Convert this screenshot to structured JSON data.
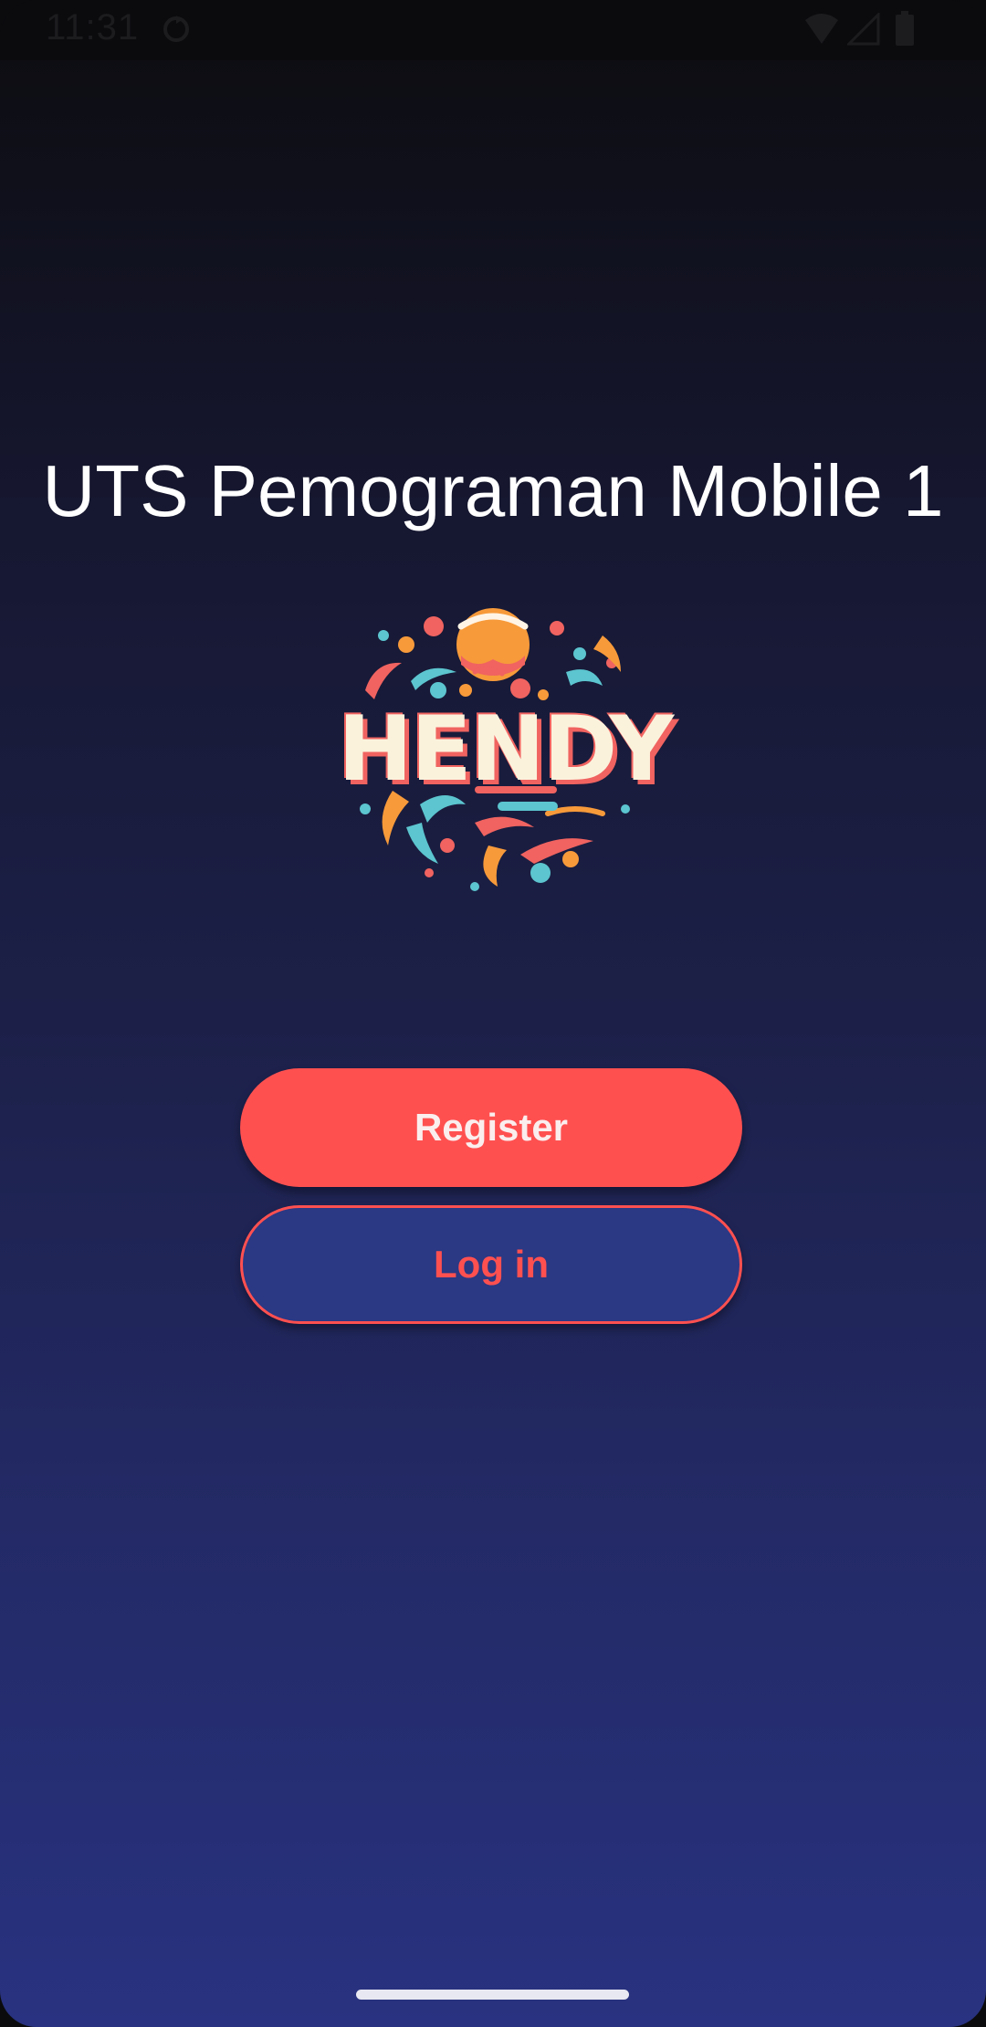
{
  "status_bar": {
    "time": "11:31",
    "icons": [
      "sync-icon",
      "wifi-icon",
      "signal-icon",
      "battery-icon"
    ]
  },
  "main": {
    "title": "UTS Pemograman Mobile 1",
    "logo_text": "HENDY"
  },
  "actions": {
    "register_label": "Register",
    "login_label": "Log in"
  },
  "colors": {
    "accent": "#ff5050",
    "login_bg": "#2b3884",
    "gradient_top": "#0c0c0f",
    "gradient_bottom": "#283280"
  }
}
